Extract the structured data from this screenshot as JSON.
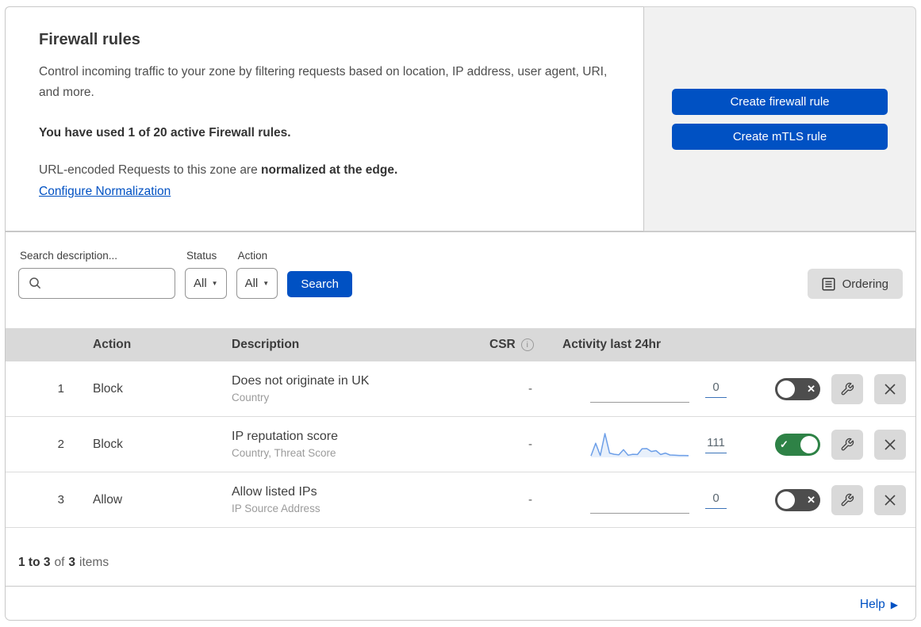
{
  "header": {
    "title": "Firewall rules",
    "description": "Control incoming traffic to your zone by filtering requests based on location, IP address, user agent, URI, and more.",
    "usage": "You have used 1 of 20 active Firewall rules.",
    "normalization_prefix": "URL-encoded Requests to this zone are ",
    "normalization_bold": "normalized at the edge.",
    "normalization_link": "Configure Normalization"
  },
  "actions_panel": {
    "create_firewall_label": "Create firewall rule",
    "create_mtls_label": "Create mTLS rule"
  },
  "filters": {
    "search_label": "Search description...",
    "status_label": "Status",
    "status_value": "All",
    "action_label": "Action",
    "action_value": "All",
    "search_button": "Search",
    "ordering_button": "Ordering"
  },
  "table": {
    "headers": {
      "action": "Action",
      "description": "Description",
      "csr": "CSR",
      "info_icon_glyph": "i",
      "activity": "Activity last 24hr"
    },
    "rows": [
      {
        "index": "1",
        "action": "Block",
        "description": "Does not originate in UK",
        "fields": "Country",
        "csr": "-",
        "count": "0",
        "enabled": false,
        "sparkline": []
      },
      {
        "index": "2",
        "action": "Block",
        "description": "IP reputation score",
        "fields": "Country, Threat Score",
        "csr": "-",
        "count": "111",
        "enabled": true,
        "sparkline": [
          3,
          58,
          5,
          100,
          15,
          10,
          8,
          30,
          6,
          10,
          9,
          34,
          35,
          22,
          26,
          9,
          15,
          7,
          6,
          5,
          5,
          4
        ]
      },
      {
        "index": "3",
        "action": "Allow",
        "description": "Allow listed IPs",
        "fields": "IP Source Address",
        "csr": "-",
        "count": "0",
        "enabled": false,
        "sparkline": []
      }
    ],
    "footer": {
      "range_bold": "1 to 3",
      "of_text": "of",
      "total_bold": "3",
      "items_text": "items"
    }
  },
  "help": {
    "label": "Help"
  },
  "colors": {
    "accent_blue": "#0051c3",
    "toggle_on_green": "#2e8246",
    "toggle_off_gray": "#4d4d4d",
    "sparkline_blue": "#6d9fe8",
    "table_header_gray": "#d9d9d9"
  }
}
